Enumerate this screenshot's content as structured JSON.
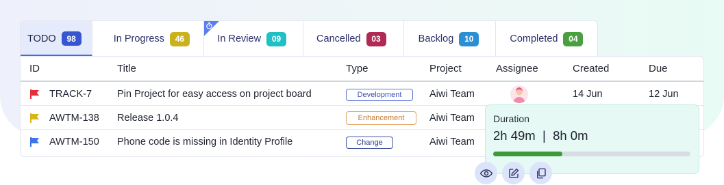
{
  "colors": {
    "todo": "#3756d0",
    "in_progress": "#c9b21d",
    "in_review": "#21c0c4",
    "cancelled": "#b02a55",
    "backlog": "#2a8fd3",
    "completed": "#4aa041",
    "flag_red": "#e5303b",
    "flag_yellow": "#d8b61a",
    "flag_blue": "#3f75ec",
    "progress": "#3e9a35"
  },
  "tabs": [
    {
      "label": "TODO",
      "count": "98"
    },
    {
      "label": "In Progress",
      "count": "46"
    },
    {
      "label": "In Review",
      "count": "09"
    },
    {
      "label": "Cancelled",
      "count": "03"
    },
    {
      "label": "Backlog",
      "count": "10"
    },
    {
      "label": "Completed",
      "count": "04"
    }
  ],
  "table": {
    "headers": {
      "id": "ID",
      "title": "Title",
      "type": "Type",
      "project": "Project",
      "assignee": "Assignee",
      "created": "Created",
      "due": "Due"
    },
    "rows": [
      {
        "id": "TRACK-7",
        "title": "Pin Project for easy access on project board",
        "type": "Development",
        "project": "Aiwi Team",
        "created": "14 Jun",
        "due": "12 Jun",
        "flag": "red-flag-icon"
      },
      {
        "id": "AWTM-138",
        "title": "Release 1.0.4",
        "type": "Enhancement",
        "project": "Aiwi Team",
        "created": "",
        "due": "",
        "flag": "yellow-flag-icon"
      },
      {
        "id": "AWTM-150",
        "title": "Phone code is missing in Identity Profile",
        "type": "Change",
        "project": "Aiwi Team",
        "created": "",
        "due": "",
        "flag": "blue-flag-icon"
      }
    ]
  },
  "duration": {
    "label": "Duration",
    "value": "2h 49m  |  8h 0m",
    "progress_fraction": 0.35
  },
  "actions": [
    "eye-icon",
    "edit-icon",
    "copy-icon"
  ]
}
